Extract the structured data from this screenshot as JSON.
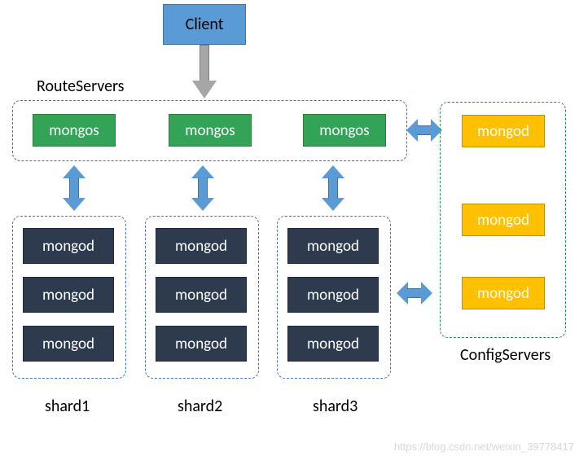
{
  "client": {
    "label": "Client"
  },
  "route": {
    "label": "RouteServers",
    "mongos": [
      {
        "label": "mongos"
      },
      {
        "label": "mongos"
      },
      {
        "label": "mongos"
      }
    ]
  },
  "config": {
    "label": "ConfigServers",
    "mongod": [
      {
        "label": "mongod"
      },
      {
        "label": "mongod"
      },
      {
        "label": "mongod"
      }
    ]
  },
  "shards": [
    {
      "label": "shard1",
      "mongod": [
        {
          "label": "mongod"
        },
        {
          "label": "mongod"
        },
        {
          "label": "mongod"
        }
      ]
    },
    {
      "label": "shard2",
      "mongod": [
        {
          "label": "mongod"
        },
        {
          "label": "mongod"
        },
        {
          "label": "mongod"
        }
      ]
    },
    {
      "label": "shard3",
      "mongod": [
        {
          "label": "mongod"
        },
        {
          "label": "mongod"
        },
        {
          "label": "mongod"
        }
      ]
    }
  ],
  "watermark": "https://blog.csdn.net/weixin_39778417"
}
